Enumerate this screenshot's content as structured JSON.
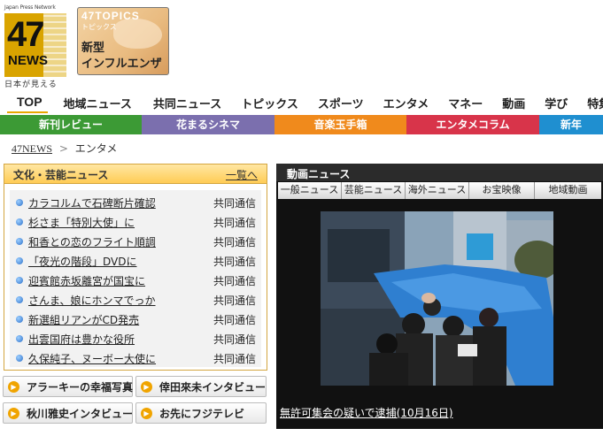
{
  "logo": {
    "tagline_top": "Japan Press Network",
    "number": "47",
    "word": "NEWS",
    "tagline_bottom": "日本が見える"
  },
  "topic_banner": {
    "line1": "47TOPICS",
    "line2": "トピックス",
    "line3": "新型",
    "line4": "インフルエンザ"
  },
  "global_nav": [
    {
      "label": "TOP",
      "active": true
    },
    {
      "label": "地域ニュース"
    },
    {
      "label": "共同ニュース"
    },
    {
      "label": "トピックス"
    },
    {
      "label": "スポーツ"
    },
    {
      "label": "エンタメ"
    },
    {
      "label": "マネー"
    },
    {
      "label": "動画"
    },
    {
      "label": "学び"
    },
    {
      "label": "特集"
    }
  ],
  "sub_nav": [
    {
      "label": "新刊レビュー",
      "color": "#3c9a35"
    },
    {
      "label": "花まるシネマ",
      "color": "#7b6fae"
    },
    {
      "label": "音楽玉手箱",
      "color": "#f08a1c"
    },
    {
      "label": "エンタメコラム",
      "color": "#d8344a"
    },
    {
      "label": "新年",
      "color": "#1f8fd0"
    }
  ],
  "breadcrumb": {
    "home": "47NEWS",
    "separator": ">",
    "current": "エンタメ"
  },
  "culture_news": {
    "title": "文化・芸能ニュース",
    "more_link": "一覧へ",
    "items": [
      {
        "title": "カラコルムで石碑断片確認",
        "source": "共同通信"
      },
      {
        "title": "杉さま「特別大使」に",
        "source": "共同通信"
      },
      {
        "title": "和香との恋のフライト順調",
        "source": "共同通信"
      },
      {
        "title": "「夜光の階段」DVDに",
        "source": "共同通信"
      },
      {
        "title": "迎賓館赤坂離宮が国宝に",
        "source": "共同通信"
      },
      {
        "title": "さんま、娘にホンマでっか",
        "source": "共同通信"
      },
      {
        "title": "新選組リアンがCD発売",
        "source": "共同通信"
      },
      {
        "title": "出雲国府は豊かな役所",
        "source": "共同通信"
      },
      {
        "title": "久保純子、ヌーボー大使に",
        "source": "共同通信"
      }
    ]
  },
  "promos": [
    {
      "label": "アラーキーの幸福写真"
    },
    {
      "label": "倖田來未インタビュー"
    },
    {
      "label": "秋川雅史インタビュー"
    },
    {
      "label": "お先にフジテレビ"
    }
  ],
  "video_news": {
    "title": "動画ニュース",
    "tabs": [
      "一般ニュース",
      "芸能ニュース",
      "海外ニュース",
      "お宝映像",
      "地域動画"
    ],
    "caption": "無許可集会の疑いで逮捕(10月16日)"
  },
  "colors": {
    "accent": "#e8a800",
    "culture_border": "#d4a640",
    "video_bg": "#111111"
  }
}
